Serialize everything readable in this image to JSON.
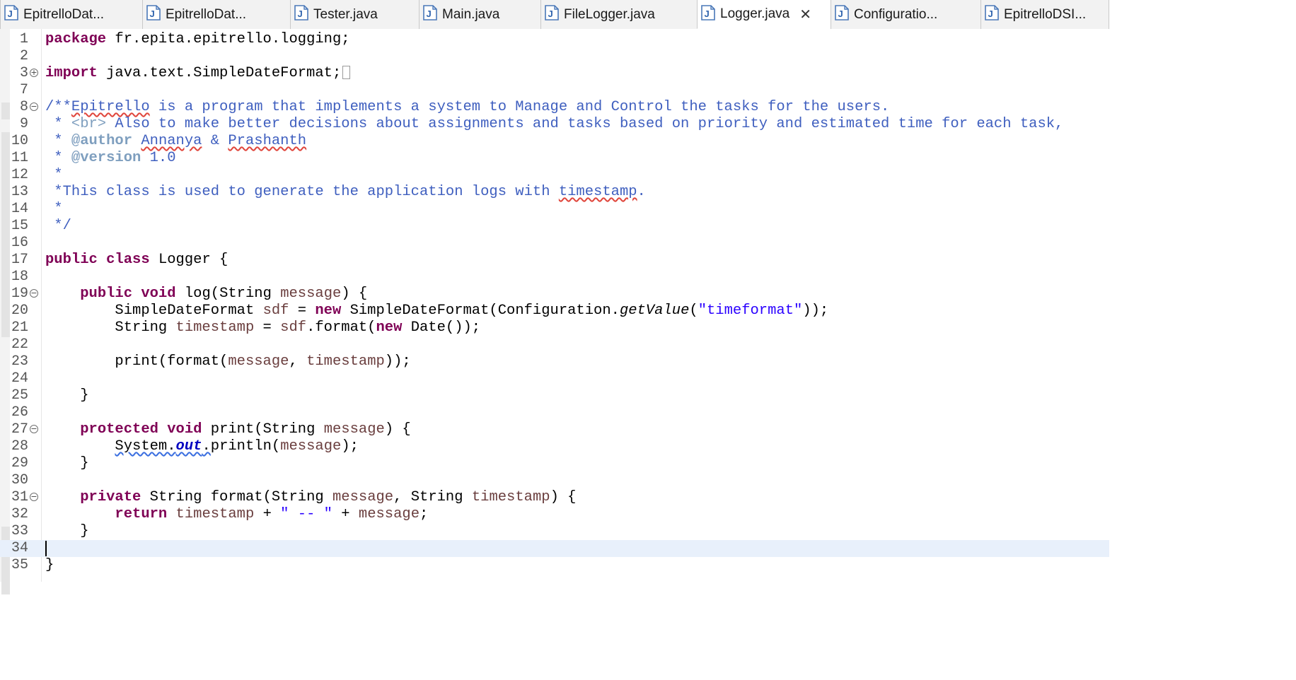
{
  "tabs": [
    {
      "label": "EpitrelloDat...",
      "icon": "java-file-icon"
    },
    {
      "label": "EpitrelloDat...",
      "icon": "java-file-icon"
    },
    {
      "label": "Tester.java",
      "icon": "java-file-icon"
    },
    {
      "label": "Main.java",
      "icon": "java-file-icon"
    },
    {
      "label": "FileLogger.java",
      "icon": "java-file-icon"
    },
    {
      "label": "Logger.java",
      "icon": "java-file-icon",
      "active": true,
      "close": "✕"
    },
    {
      "label": "Configuratio...",
      "icon": "java-file-icon"
    },
    {
      "label": "EpitrelloDSI...",
      "icon": "java-file-icon"
    }
  ],
  "editor": {
    "current_line": "34",
    "lines": [
      {
        "n": "1",
        "tokens": [
          {
            "t": "package",
            "c": "k"
          },
          {
            "t": " fr.epita.epitrello.logging;"
          }
        ]
      },
      {
        "n": "2",
        "tokens": []
      },
      {
        "n": "3",
        "fold": "+",
        "tokens": [
          {
            "t": "import",
            "c": "k"
          },
          {
            "t": " java.text.SimpleDateFormat;"
          },
          {
            "box": true
          }
        ]
      },
      {
        "n": "7",
        "tokens": []
      },
      {
        "n": "8",
        "fold": "−",
        "tokens": [
          {
            "t": "/**",
            "c": "c"
          },
          {
            "t": "Epitrello",
            "c": "c spell"
          },
          {
            "t": " is a program that implements a system to Manage and Control the tasks for the users.",
            "c": "c"
          }
        ]
      },
      {
        "n": "9",
        "tokens": [
          {
            "t": " * ",
            "c": "c"
          },
          {
            "t": "<br>",
            "c": "ct"
          },
          {
            "t": " Also to make better decisions about assignments and tasks based on priority and estimated time for each task,",
            "c": "c"
          }
        ]
      },
      {
        "n": "10",
        "tokens": [
          {
            "t": " * ",
            "c": "c"
          },
          {
            "t": "@author",
            "c": "ctag"
          },
          {
            "t": " ",
            "c": "c"
          },
          {
            "t": "Annanya",
            "c": "c spell"
          },
          {
            "t": " & ",
            "c": "c"
          },
          {
            "t": "Prashanth",
            "c": "c spell"
          }
        ]
      },
      {
        "n": "11",
        "tokens": [
          {
            "t": " * ",
            "c": "c"
          },
          {
            "t": "@version",
            "c": "ctag"
          },
          {
            "t": " 1.0",
            "c": "c"
          }
        ]
      },
      {
        "n": "12",
        "tokens": [
          {
            "t": " *",
            "c": "c"
          }
        ]
      },
      {
        "n": "13",
        "tokens": [
          {
            "t": " *This class is used to generate the application logs with ",
            "c": "c"
          },
          {
            "t": "timestamp",
            "c": "c spell"
          },
          {
            "t": ".",
            "c": "c"
          }
        ]
      },
      {
        "n": "14",
        "tokens": [
          {
            "t": " *",
            "c": "c"
          }
        ]
      },
      {
        "n": "15",
        "tokens": [
          {
            "t": " */",
            "c": "c"
          }
        ]
      },
      {
        "n": "16",
        "tokens": []
      },
      {
        "n": "17",
        "tokens": [
          {
            "t": "public",
            "c": "k"
          },
          {
            "t": " "
          },
          {
            "t": "class",
            "c": "k"
          },
          {
            "t": " Logger {"
          }
        ]
      },
      {
        "n": "18",
        "tokens": []
      },
      {
        "n": "19",
        "fold": "−",
        "tokens": [
          {
            "t": "    "
          },
          {
            "t": "public",
            "c": "k"
          },
          {
            "t": " "
          },
          {
            "t": "void",
            "c": "k"
          },
          {
            "t": " log(String "
          },
          {
            "t": "message",
            "c": "v"
          },
          {
            "t": ") {"
          }
        ]
      },
      {
        "n": "20",
        "tokens": [
          {
            "t": "        SimpleDateFormat "
          },
          {
            "t": "sdf",
            "c": "v"
          },
          {
            "t": " = "
          },
          {
            "t": "new",
            "c": "k"
          },
          {
            "t": " SimpleDateFormat(Configuration."
          },
          {
            "t": "getValue",
            "c": "it"
          },
          {
            "t": "("
          },
          {
            "t": "\"timeformat\"",
            "c": "s"
          },
          {
            "t": "));"
          }
        ]
      },
      {
        "n": "21",
        "tokens": [
          {
            "t": "        String "
          },
          {
            "t": "timestamp",
            "c": "v"
          },
          {
            "t": " = "
          },
          {
            "t": "sdf",
            "c": "v"
          },
          {
            "t": ".format("
          },
          {
            "t": "new",
            "c": "k"
          },
          {
            "t": " Date());"
          }
        ]
      },
      {
        "n": "22",
        "tokens": []
      },
      {
        "n": "23",
        "tokens": [
          {
            "t": "        print(format("
          },
          {
            "t": "message",
            "c": "v"
          },
          {
            "t": ", "
          },
          {
            "t": "timestamp",
            "c": "v"
          },
          {
            "t": "));"
          }
        ]
      },
      {
        "n": "24",
        "tokens": []
      },
      {
        "n": "25",
        "tokens": [
          {
            "t": "    }"
          }
        ]
      },
      {
        "n": "26",
        "tokens": []
      },
      {
        "n": "27",
        "fold": "−",
        "tokens": [
          {
            "t": "    "
          },
          {
            "t": "protected",
            "c": "k"
          },
          {
            "t": " "
          },
          {
            "t": "void",
            "c": "k"
          },
          {
            "t": " print(String "
          },
          {
            "t": "message",
            "c": "v"
          },
          {
            "t": ") {"
          }
        ]
      },
      {
        "n": "28",
        "tokens": [
          {
            "t": "        "
          },
          {
            "t": "System.",
            "c": "warn"
          },
          {
            "t": "out",
            "c": "sf warn"
          },
          {
            "t": ".",
            "c": "warn"
          },
          {
            "t": "println("
          },
          {
            "t": "message",
            "c": "v"
          },
          {
            "t": ");"
          }
        ]
      },
      {
        "n": "29",
        "tokens": [
          {
            "t": "    }"
          }
        ]
      },
      {
        "n": "30",
        "tokens": []
      },
      {
        "n": "31",
        "fold": "−",
        "tokens": [
          {
            "t": "    "
          },
          {
            "t": "private",
            "c": "k"
          },
          {
            "t": " String format(String "
          },
          {
            "t": "message",
            "c": "v"
          },
          {
            "t": ", String "
          },
          {
            "t": "timestamp",
            "c": "v"
          },
          {
            "t": ") {"
          }
        ]
      },
      {
        "n": "32",
        "tokens": [
          {
            "t": "        "
          },
          {
            "t": "return",
            "c": "k"
          },
          {
            "t": " "
          },
          {
            "t": "timestamp",
            "c": "v"
          },
          {
            "t": " + "
          },
          {
            "t": "\" -- \"",
            "c": "s"
          },
          {
            "t": " + "
          },
          {
            "t": "message",
            "c": "v"
          },
          {
            "t": ";"
          }
        ]
      },
      {
        "n": "33",
        "tokens": [
          {
            "t": "    }"
          }
        ]
      },
      {
        "n": "34",
        "tokens": []
      },
      {
        "n": "35",
        "tokens": [
          {
            "t": "}"
          }
        ]
      }
    ]
  }
}
